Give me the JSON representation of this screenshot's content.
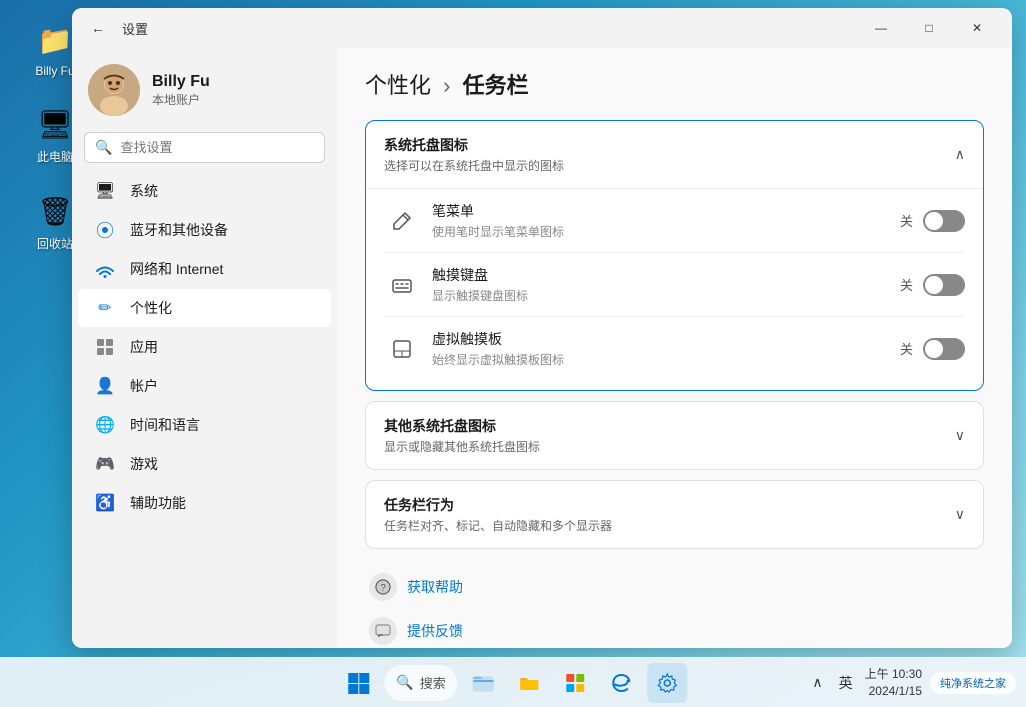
{
  "desktop": {
    "icons": [
      {
        "id": "folder",
        "symbol": "📁",
        "label": "Billy Fu"
      },
      {
        "id": "computer",
        "symbol": "🖥",
        "label": "此电脑"
      },
      {
        "id": "trash",
        "symbol": "🗑",
        "label": "回收站"
      }
    ]
  },
  "taskbar": {
    "start_label": "⊞",
    "search_placeholder": "搜索",
    "icons": [
      {
        "id": "file-explorer",
        "symbol": "🗂",
        "label": "文件资源管理器"
      },
      {
        "id": "folder-yellow",
        "symbol": "📂",
        "label": "文件夹"
      },
      {
        "id": "ms-store",
        "symbol": "⊞",
        "label": "Microsoft Store"
      },
      {
        "id": "edge",
        "symbol": "🌐",
        "label": "Microsoft Edge"
      },
      {
        "id": "settings",
        "symbol": "⚙",
        "label": "设置"
      }
    ],
    "systray": {
      "caret_label": "∧",
      "lang_label": "英",
      "time": "上午 10:30",
      "date": "2024/1/15"
    },
    "brand": "纯净系统之家"
  },
  "window": {
    "title": "设置",
    "controls": {
      "minimize": "—",
      "maximize": "□",
      "close": "✕"
    }
  },
  "sidebar": {
    "user": {
      "name": "Billy Fu",
      "account_type": "本地账户"
    },
    "search_placeholder": "查找设置",
    "nav_items": [
      {
        "id": "system",
        "icon": "🖥",
        "label": "系统",
        "active": false
      },
      {
        "id": "bluetooth",
        "icon": "Ⓑ",
        "label": "蓝牙和其他设备",
        "active": false
      },
      {
        "id": "network",
        "icon": "📶",
        "label": "网络和 Internet",
        "active": false
      },
      {
        "id": "personalization",
        "icon": "✏",
        "label": "个性化",
        "active": true
      },
      {
        "id": "apps",
        "icon": "📋",
        "label": "应用",
        "active": false
      },
      {
        "id": "accounts",
        "icon": "👤",
        "label": "帐户",
        "active": false
      },
      {
        "id": "time",
        "icon": "🌐",
        "label": "时间和语言",
        "active": false
      },
      {
        "id": "games",
        "icon": "🎮",
        "label": "游戏",
        "active": false
      },
      {
        "id": "accessibility",
        "icon": "♿",
        "label": "辅助功能",
        "active": false
      }
    ]
  },
  "main": {
    "breadcrumb": {
      "parent": "个性化",
      "separator": "›",
      "current": "任务栏"
    },
    "sections": [
      {
        "id": "system-tray-icons",
        "title": "系统托盘图标",
        "subtitle": "选择可以在系统托盘中显示的图标",
        "expanded": true,
        "chevron": "∧",
        "items": [
          {
            "id": "pen-menu",
            "icon": "✒",
            "name": "笔菜单",
            "desc": "使用笔时显示笔菜单图标",
            "toggle_label": "关",
            "on": false
          },
          {
            "id": "touch-keyboard",
            "icon": "⌨",
            "name": "触摸键盘",
            "desc": "显示触摸键盘图标",
            "toggle_label": "关",
            "on": false
          },
          {
            "id": "virtual-touchpad",
            "icon": "⬜",
            "name": "虚拟触摸板",
            "desc": "始终显示虚拟触摸板图标",
            "toggle_label": "关",
            "on": false
          }
        ]
      },
      {
        "id": "other-tray-icons",
        "title": "其他系统托盘图标",
        "subtitle": "显示或隐藏其他系统托盘图标",
        "expanded": false,
        "chevron": "∨",
        "items": []
      },
      {
        "id": "taskbar-behavior",
        "title": "任务栏行为",
        "subtitle": "任务栏对齐、标记、自动隐藏和多个显示器",
        "expanded": false,
        "chevron": "∨",
        "items": []
      }
    ],
    "help": {
      "items": [
        {
          "id": "get-help",
          "icon": "?",
          "label": "获取帮助"
        },
        {
          "id": "feedback",
          "icon": "💬",
          "label": "提供反馈"
        }
      ]
    }
  }
}
